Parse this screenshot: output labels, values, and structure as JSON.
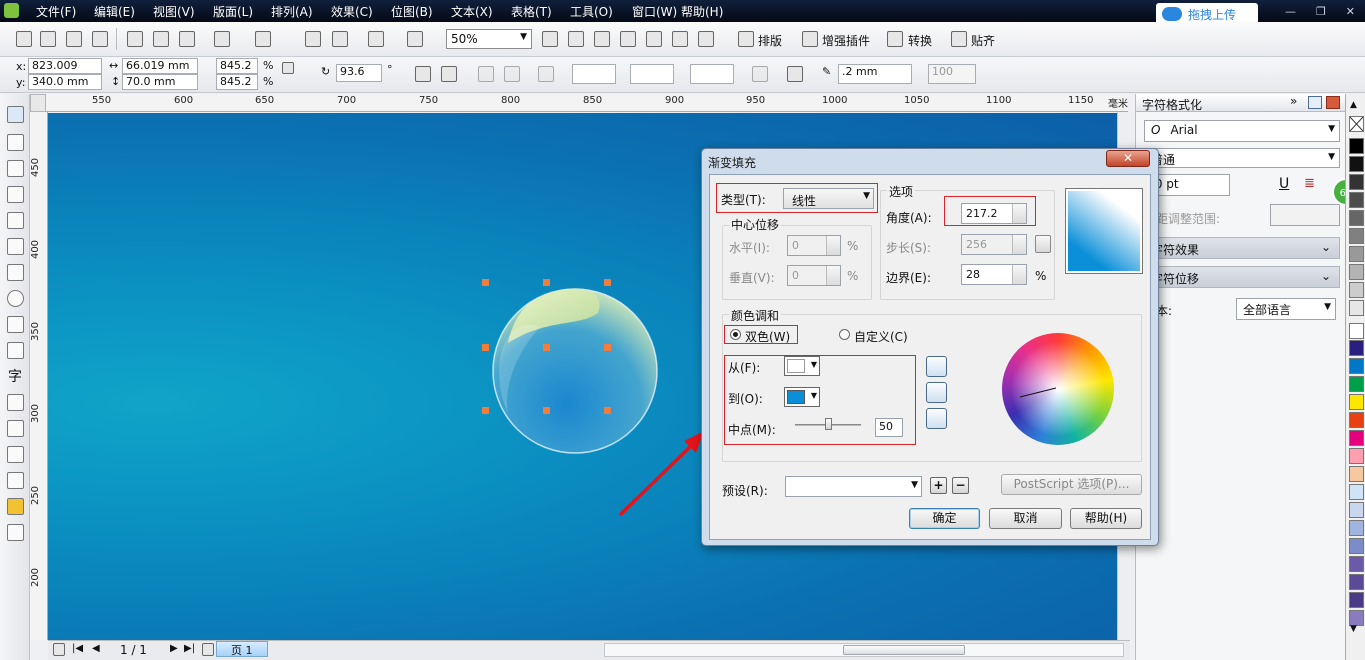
{
  "menu": [
    "文件(F)",
    "编辑(E)",
    "视图(V)",
    "版面(L)",
    "排列(A)",
    "效果(C)",
    "位图(B)",
    "文本(X)",
    "表格(T)",
    "工具(O)",
    "窗口(W)",
    "帮助(H)"
  ],
  "upload_label": "拖拽上传",
  "toolbar": {
    "zoom": "50%",
    "layout_label": "排版",
    "plugin_label": "增强插件",
    "convert_label": "转换",
    "paste_label": "贴齐"
  },
  "props": {
    "x_label": "x:",
    "x": "823.009 mm",
    "y_label": "y:",
    "y": "340.0 mm",
    "w": "66.019 mm",
    "h": "70.0 mm",
    "sx": "845.2",
    "sy": "845.2",
    "pct": "%",
    "angle": "93.6",
    "deg": "°",
    "outline": ".2 mm",
    "opacity": "100"
  },
  "ruler_top": [
    "550",
    "600",
    "650",
    "700",
    "750",
    "800",
    "850",
    "900",
    "950",
    "1000",
    "1050",
    "1100",
    "1150",
    "毫米"
  ],
  "ruler_left": [
    "450",
    "400",
    "350",
    "300",
    "250",
    "200"
  ],
  "pager": {
    "page_count": "1 / 1",
    "tab": "页 1"
  },
  "docker": {
    "title": "字符格式化",
    "font": "Arial",
    "style": "普通",
    "size": ".0 pt",
    "kerning_label": "字距调整范围:",
    "effects_label": "字符效果",
    "offset_label": "字符位移",
    "script_label": "脚本:",
    "script_value": "全部语言",
    "badge": "65"
  },
  "palette": [
    "#ffffff",
    "#000000",
    "#111111",
    "#333333",
    "#4d4d4d",
    "#666666",
    "#808080",
    "#999999",
    "#b3b3b3",
    "#cccccc",
    "#e6e6e6",
    "#ffffff",
    "#2a1e7e",
    "#0078c8",
    "#00a04a",
    "#ffe600",
    "#e84010",
    "#e6007e",
    "#ff9fb0",
    "#f5c8a0",
    "#cfe4f6",
    "#c8d6ef",
    "#9fb4de",
    "#7c8cc8",
    "#6a5aa8",
    "#5a4a98",
    "#4a3a88",
    "#8a7ac0"
  ],
  "dialog": {
    "title": "渐变填充",
    "close": "✕",
    "type_label": "类型(T):",
    "type_value": "线性",
    "options_label": "选项",
    "angle_label": "角度(A):",
    "angle": "217.2",
    "steps_label": "步长(S):",
    "steps": "256",
    "edge_label": "边界(E):",
    "edge": "28",
    "edge_pct": "%",
    "center_label": "中心位移",
    "h_label": "水平(I):",
    "h_val": "0",
    "v_label": "垂直(V):",
    "v_val": "0",
    "pct": "%",
    "blend_label": "颜色调和",
    "two_color": "双色(W)",
    "custom": "自定义(C)",
    "from_label": "从(F):",
    "to_label": "到(O):",
    "mid_label": "中点(M):",
    "mid": "50",
    "from_color": "#ffffff",
    "to_color": "#0a8fd8",
    "preset_label": "预设(R):",
    "ps_options": "PostScript 选项(P)...",
    "ok": "确定",
    "cancel": "取消",
    "help": "帮助(H)"
  }
}
